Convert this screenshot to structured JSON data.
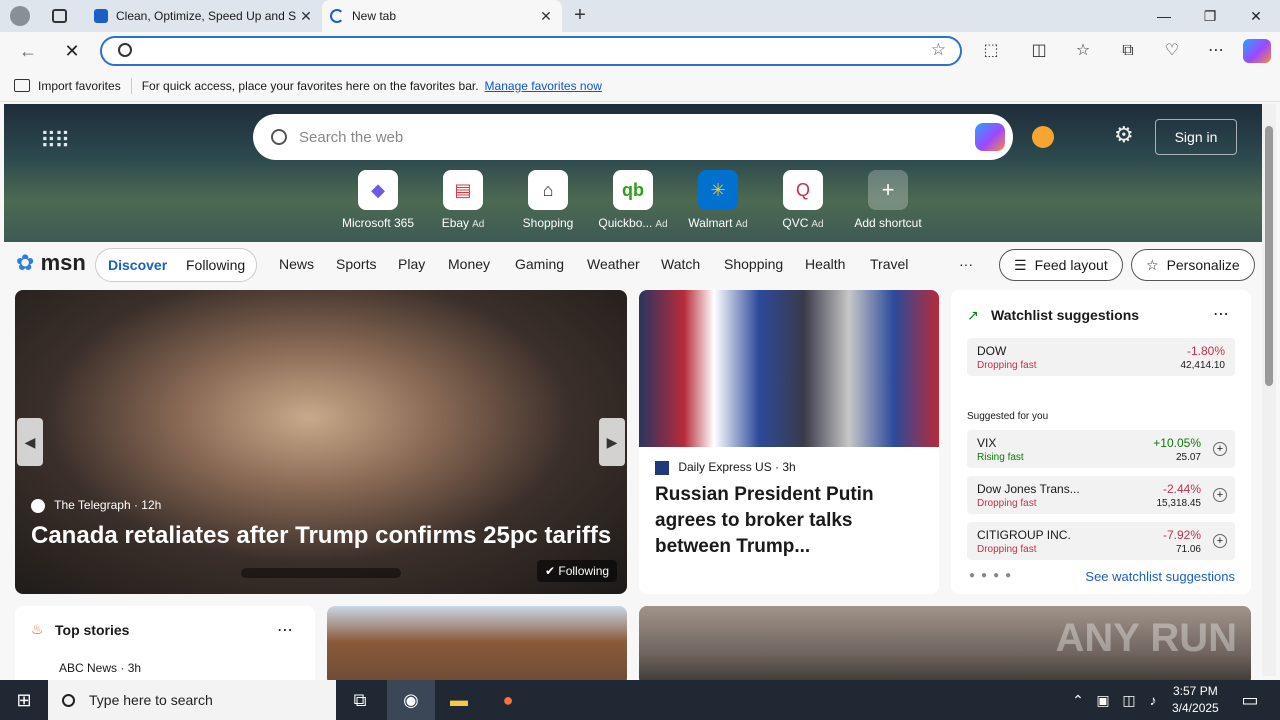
{
  "browser": {
    "tabs": [
      {
        "title": "Clean, Optimize, Speed Up and S",
        "close": "✕"
      },
      {
        "title": "New tab",
        "close": "✕"
      }
    ],
    "new_tab": "+",
    "window_controls": {
      "minimize": "—",
      "restore": "❐",
      "close": "✕"
    }
  },
  "address": {
    "placeholder": ""
  },
  "favorites_bar": {
    "import_label": "Import favorites",
    "hint": "For quick access, place your favorites here on the favorites bar.",
    "manage_link": "Manage favorites now"
  },
  "hero": {
    "search_placeholder": "Search the web",
    "sign_in": "Sign in",
    "shortcuts": [
      {
        "label": "Microsoft 365",
        "ad": ""
      },
      {
        "label": "Ebay",
        "ad": "Ad"
      },
      {
        "label": "Shopping",
        "ad": ""
      },
      {
        "label": "Quickbo...",
        "ad": "Ad"
      },
      {
        "label": "Walmart",
        "ad": "Ad"
      },
      {
        "label": "QVC",
        "ad": "Ad"
      },
      {
        "label": "Add shortcut",
        "ad": ""
      }
    ]
  },
  "msn": {
    "logo": "msn",
    "discover": "Discover",
    "following": "Following",
    "nav": [
      "News",
      "Sports",
      "Play",
      "Money",
      "Gaming",
      "Weather",
      "Watch",
      "Shopping",
      "Health",
      "Travel"
    ],
    "more": "···",
    "feed_layout": "Feed layout",
    "personalize": "Personalize"
  },
  "main_story": {
    "source": "The Telegraph",
    "age": "12h",
    "headline": "Canada retaliates after Trump confirms 25pc tariffs",
    "following": "Following"
  },
  "story2": {
    "source": "Daily Express US",
    "age": "3h",
    "headline": "Russian President Putin agrees to broker talks between Trump..."
  },
  "watchlist": {
    "title": "Watchlist suggestions",
    "top": {
      "name": "DOW",
      "status": "Dropping fast",
      "change": "-1.80%",
      "price": "42,414.10"
    },
    "suggested_label": "Suggested for you",
    "items": [
      {
        "name": "VIX",
        "status": "Rising fast",
        "change": "+10.05%",
        "price": "25.07"
      },
      {
        "name": "Dow Jones Trans...",
        "status": "Dropping fast",
        "change": "-2.44%",
        "price": "15,318.45"
      },
      {
        "name": "CITIGROUP INC.",
        "status": "Dropping fast",
        "change": "-7.92%",
        "price": "71.06"
      }
    ],
    "see_all": "See watchlist suggestions"
  },
  "top_stories": {
    "title": "Top stories",
    "source": "ABC News",
    "age": "3h"
  },
  "watermark": "ANY RUN",
  "taskbar": {
    "search_placeholder": "Type here to search",
    "time": "3:57 PM",
    "date": "3/4/2025"
  }
}
